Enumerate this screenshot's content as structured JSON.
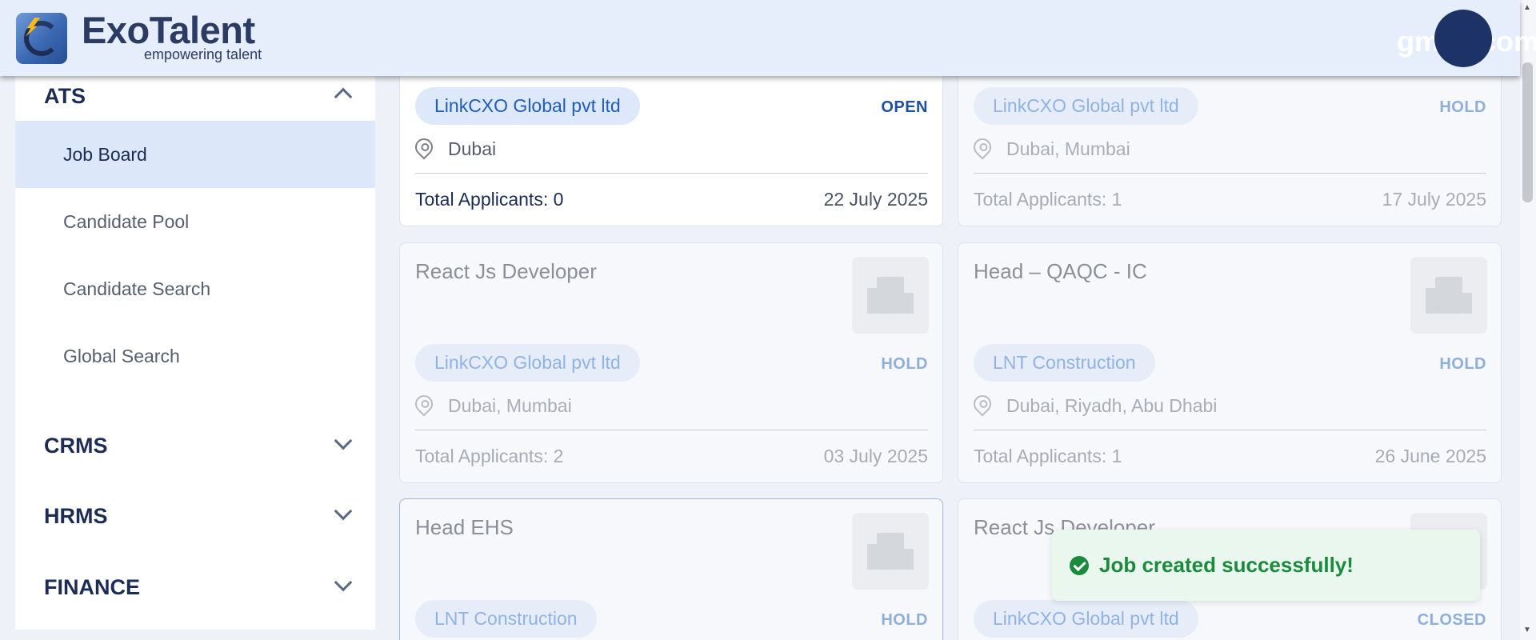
{
  "header": {
    "brand": "ExoTalent",
    "tagline": "empowering talent",
    "user_label": "gmail.com"
  },
  "sidebar": {
    "sections": [
      {
        "label": "ATS",
        "expanded": true,
        "items": [
          "Job Board",
          "Candidate Pool",
          "Candidate Search",
          "Global Search"
        ],
        "active": "Job Board"
      },
      {
        "label": "CRMS",
        "expanded": false
      },
      {
        "label": "HRMS",
        "expanded": false
      },
      {
        "label": "FINANCE",
        "expanded": false
      }
    ]
  },
  "cards": [
    {
      "title": "",
      "company": "LinkCXO Global pvt ltd",
      "status": "OPEN",
      "location": "Dubai",
      "applicants": "Total Applicants: 0",
      "date": "22 July 2025"
    },
    {
      "title": "",
      "company": "LinkCXO Global pvt ltd",
      "status": "HOLD",
      "location": "Dubai, Mumbai",
      "applicants": "Total Applicants: 1",
      "date": "17 July 2025"
    },
    {
      "title": "React Js Developer",
      "company": "LinkCXO Global pvt ltd",
      "status": "HOLD",
      "location": "Dubai, Mumbai",
      "applicants": "Total Applicants: 2",
      "date": "03 July 2025"
    },
    {
      "title": "Head – QAQC - IC",
      "company": "LNT Construction",
      "status": "HOLD",
      "location": "Dubai, Riyadh, Abu Dhabi",
      "applicants": "Total Applicants: 1",
      "date": "26 June 2025"
    },
    {
      "title": "Head EHS",
      "company": "LNT Construction",
      "status": "HOLD"
    },
    {
      "title": "React Js Developer",
      "company": "LinkCXO Global pvt ltd",
      "status": "CLOSED"
    }
  ],
  "toast": {
    "message": "Job created successfully!",
    "type": "success"
  },
  "colors": {
    "accent": "#1f5db8",
    "success": "#1a8a3c",
    "sidebar_active": "#dce8f9"
  }
}
